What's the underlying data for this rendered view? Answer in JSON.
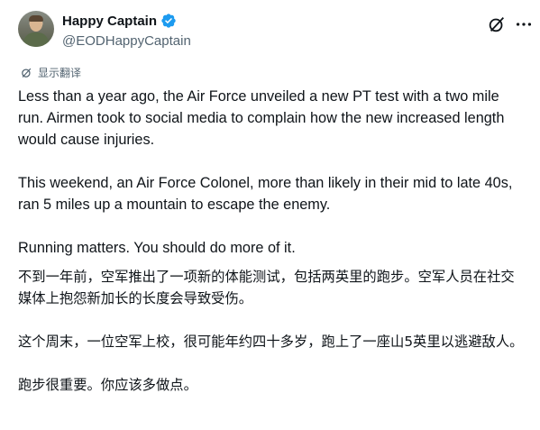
{
  "author": {
    "display_name": "Happy Captain",
    "handle": "@EODHappyCaptain",
    "verified_color": "#1d9bf0"
  },
  "actions": {
    "grok_icon": "grok-icon",
    "more_icon": "more-icon"
  },
  "translate": {
    "label": "显示翻译",
    "icon": "translate-icon"
  },
  "tweet": {
    "p1": "Less than a year ago, the Air Force unveiled a new PT test with a two mile run. Airmen took to social media to complain how the new increased length would cause injuries.",
    "p2": "This weekend, an Air Force Colonel, more than likely in their mid to late 40s, ran 5 miles up a mountain to escape the enemy.",
    "p3": "Running matters. You should do more of it."
  },
  "translation": {
    "p1": "不到一年前，空军推出了一项新的体能测试，包括两英里的跑步。空军人员在社交媒体上抱怨新加长的长度会导致受伤。",
    "p2": "这个周末，一位空军上校，很可能年约四十多岁，跑上了一座山5英里以逃避敌人。",
    "p3": "跑步很重要。你应该多做点。"
  }
}
